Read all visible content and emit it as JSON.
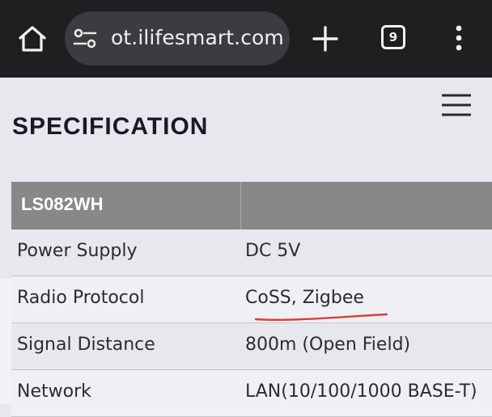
{
  "browser": {
    "url": "ot.ilifesmart.com",
    "tab_count": "9",
    "icons": {
      "home": "home-icon",
      "site_settings": "tune-icon",
      "new_tab": "plus-icon",
      "menu": "more-vert-icon"
    },
    "colors": {
      "bar": "#1e1f21",
      "urlbar": "#3b3c3f"
    }
  },
  "page": {
    "title": "SPECIFICATION",
    "menu_icon": "hamburger-icon",
    "table": {
      "header": "LS082WH",
      "rows": [
        {
          "label": "Power Supply",
          "value": "DC 5V"
        },
        {
          "label": "Radio Protocol",
          "value": "CoSS, Zigbee"
        },
        {
          "label": "Signal Distance",
          "value": "800m (Open Field)"
        },
        {
          "label": "Network",
          "value": "LAN(10/100/1000 BASE-T)"
        }
      ]
    },
    "annotation_color": "#d8403a",
    "colors": {
      "background": "#e6e8ee",
      "table_header": "#888888"
    }
  }
}
